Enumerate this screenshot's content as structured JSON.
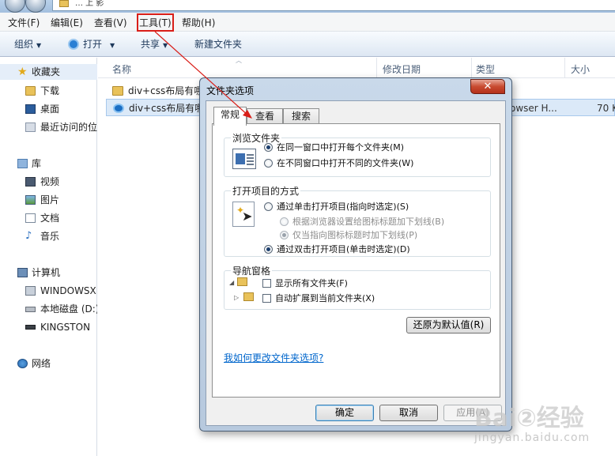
{
  "explorer": {
    "address_fragment": "… 上 影",
    "menu": [
      "文件(F)",
      "编辑(E)",
      "查看(V)",
      "工具(T)",
      "帮助(H)"
    ],
    "commands": {
      "organize": "组织",
      "open": "打开",
      "share": "共享",
      "new_folder": "新建文件夹"
    },
    "nav": {
      "favorites": "收藏夹",
      "downloads": "下载",
      "desktop": "桌面",
      "recent": "最近访问的位",
      "libraries": "库",
      "videos": "视频",
      "pictures": "图片",
      "documents": "文档",
      "music": "音乐",
      "computer": "计算机",
      "drive_c": "WINDOWSX",
      "drive_d": "本地磁盘 (D:)",
      "drive_usb": "KINGSTON",
      "network": "网络"
    },
    "columns": {
      "name": "名称",
      "modified": "修改日期",
      "type": "类型",
      "size": "大小"
    },
    "files": [
      {
        "name": "div+css布局有哪",
        "type": "",
        "size": ""
      },
      {
        "name": "div+css布局有哪",
        "type": "owser H...",
        "size": "70 K"
      }
    ]
  },
  "dialog": {
    "title": "文件夹选项",
    "close": "✕",
    "tabs": [
      "常规",
      "查看",
      "搜索"
    ],
    "browse": {
      "title": "浏览文件夹",
      "same_window": "在同一窗口中打开每个文件夹(M)",
      "new_window": "在不同窗口中打开不同的文件夹(W)",
      "selected": "same_window"
    },
    "click": {
      "title": "打开项目的方式",
      "single": "通过单击打开项目(指向时选定)(S)",
      "underline_browser": "根据浏览器设置给图标标题加下划线(B)",
      "underline_point": "仅当指向图标标题时加下划线(P)",
      "double": "通过双击打开项目(单击时选定)(D)",
      "selected": "double"
    },
    "navpane": {
      "title": "导航窗格",
      "show_all": "显示所有文件夹(F)",
      "auto_expand": "自动扩展到当前文件夹(X)"
    },
    "restore_defaults": "还原为默认值(R)",
    "help_link": "我如何更改文件夹选项?",
    "ok": "确定",
    "cancel": "取消",
    "apply": "应用(A)"
  },
  "watermark": {
    "brand": "Bai②经验",
    "url": "jingyan.baidu.com"
  },
  "colors": {
    "annotation": "#d91e18",
    "link": "#0066cc",
    "dialog_frame": "#b7c9de"
  }
}
